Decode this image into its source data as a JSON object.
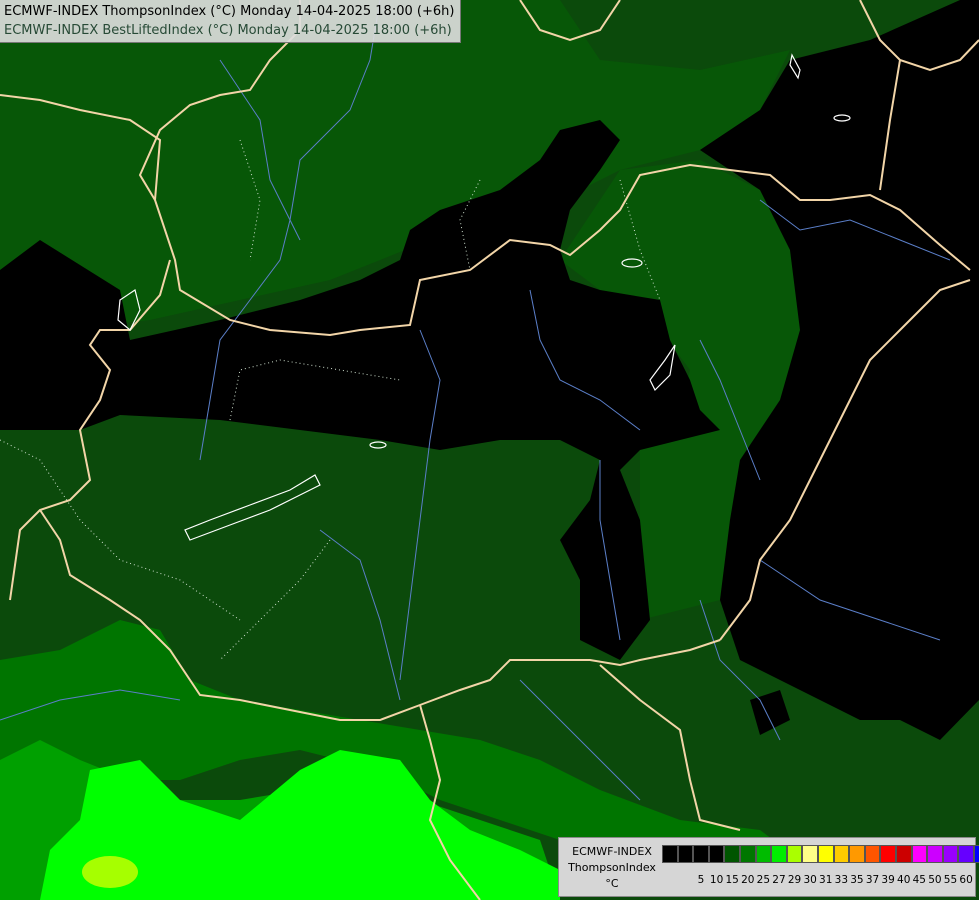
{
  "title": {
    "line1": "ECMWF-INDEX ThompsonIndex (°C) Monday 14-04-2025 18:00 (+6h)",
    "line2": "ECMWF-INDEX BestLiftedIndex (°C) Monday 14-04-2025 18:00 (+6h)",
    "line1_color": "#000000",
    "line2_color": "#274a36"
  },
  "legend": {
    "source": "ECMWF-INDEX",
    "variable": "ThompsonIndex",
    "unit": "°C",
    "ticks": [
      "5",
      "10",
      "15",
      "20",
      "25",
      "27",
      "29",
      "30",
      "31",
      "33",
      "35",
      "37",
      "39",
      "40",
      "45",
      "50",
      "55",
      "60"
    ],
    "colors": [
      "#000000",
      "#000000",
      "#000000",
      "#000000",
      "#005500",
      "#007700",
      "#00bb00",
      "#00ee00",
      "#aaff00",
      "#ffff88",
      "#ffff00",
      "#ffcc00",
      "#ff9900",
      "#ff5500",
      "#ff0000",
      "#cc0000",
      "#ff00ff",
      "#cc00ff",
      "#9900ff",
      "#6600ff",
      "#0000ff"
    ]
  },
  "map_colors": {
    "black_zone": "#000000",
    "dark_green": "#0b4a0b",
    "mid_green": "#006400",
    "green": "#009100",
    "light_green": "#00c800",
    "bright_green": "#00ff00",
    "yellow_green": "#a6ff00",
    "borders": "#f2d5a8",
    "rivers": "#5b7fc9"
  }
}
